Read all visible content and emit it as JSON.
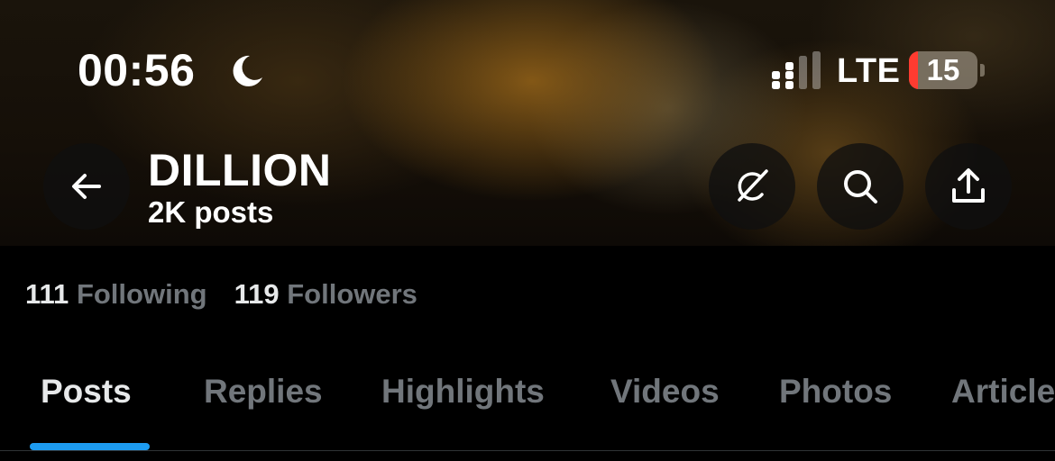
{
  "status_bar": {
    "time": "00:56",
    "network": "LTE",
    "battery": "15",
    "focus_icon": "moon-icon",
    "signal_icon": "cellular-signal-icon"
  },
  "profile": {
    "name": "DILLION",
    "posts": "2K posts",
    "following_count": "111",
    "following_label": "Following",
    "followers_count": "119",
    "followers_label": "Followers"
  },
  "header_buttons": {
    "back_icon": "arrow-left-icon",
    "grok_icon": "grok-icon",
    "search_icon": "search-icon",
    "share_icon": "share-icon"
  },
  "tabs": [
    {
      "label": "Posts",
      "active": true
    },
    {
      "label": "Replies",
      "active": false
    },
    {
      "label": "Highlights",
      "active": false
    },
    {
      "label": "Videos",
      "active": false
    },
    {
      "label": "Photos",
      "active": false
    },
    {
      "label": "Articles",
      "active": false
    }
  ],
  "colors": {
    "accent": "#1d9bf0",
    "muted_text": "#71767b",
    "primary_text": "#e7e9ea",
    "background": "#000000",
    "battery_low": "#ff3b30"
  }
}
